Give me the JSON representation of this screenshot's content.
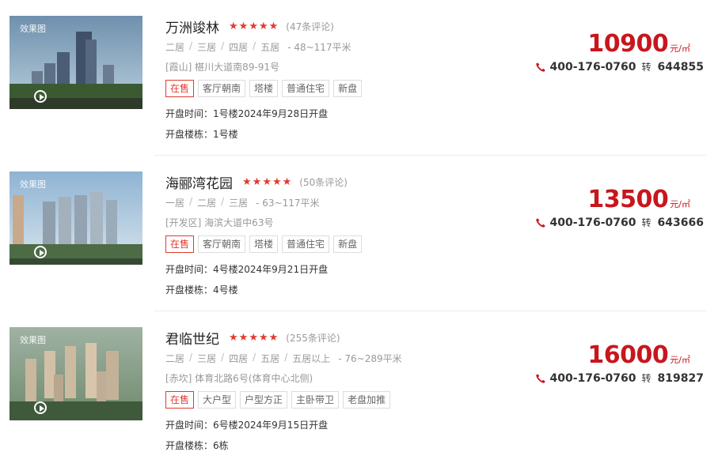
{
  "listings": [
    {
      "image_tag": "效果图",
      "name": "万洲竣林",
      "reviews": "(47条评论)",
      "rooms": [
        "二居",
        "三居",
        "四居",
        "五居"
      ],
      "area": "- 48~117平米",
      "address": "[霞山] 椹川大道南89-91号",
      "tags": [
        "在售",
        "客厅朝南",
        "塔楼",
        "普通住宅",
        "新盘"
      ],
      "open_time": "开盘时间：1号楼2024年9月28日开盘",
      "open_building": "开盘楼栋：1号楼",
      "price": "10900",
      "unit": "元/㎡",
      "phone": "400-176-0760",
      "ext_label": "转",
      "ext": "644855"
    },
    {
      "image_tag": "效果图",
      "name": "海郦湾花园",
      "reviews": "(50条评论)",
      "rooms": [
        "一居",
        "二居",
        "三居"
      ],
      "area": "- 63~117平米",
      "address": "[开发区] 海滨大道中63号",
      "tags": [
        "在售",
        "客厅朝南",
        "塔楼",
        "普通住宅",
        "新盘"
      ],
      "open_time": "开盘时间：4号楼2024年9月21日开盘",
      "open_building": "开盘楼栋：4号楼",
      "price": "13500",
      "unit": "元/㎡",
      "phone": "400-176-0760",
      "ext_label": "转",
      "ext": "643666"
    },
    {
      "image_tag": "效果图",
      "name": "君临世纪",
      "reviews": "(255条评论)",
      "rooms": [
        "二居",
        "三居",
        "四居",
        "五居",
        "五居以上"
      ],
      "area": "- 76~289平米",
      "address": "[赤坎] 体育北路6号(体育中心北侧)",
      "tags": [
        "在售",
        "大户型",
        "户型方正",
        "主卧带卫",
        "老盘加推"
      ],
      "open_time": "开盘时间：6号楼2024年9月15日开盘",
      "open_building": "开盘楼栋：6栋",
      "price": "16000",
      "unit": "元/㎡",
      "phone": "400-176-0760",
      "ext_label": "转",
      "ext": "819827"
    }
  ],
  "colors": {
    "accent": "#c8161d",
    "star": "#e03b2f"
  }
}
